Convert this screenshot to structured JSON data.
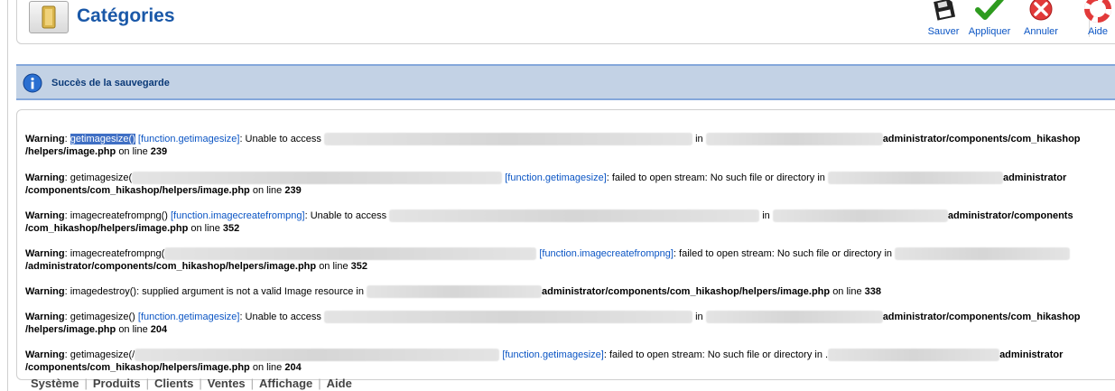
{
  "header": {
    "title": "Catégories",
    "buttons": {
      "save": "Sauver",
      "apply": "Appliquer",
      "cancel": "Annuler",
      "help": "Aide"
    }
  },
  "message": {
    "text": "Succès de la sauvegarde"
  },
  "warnings": {
    "label": "Warning",
    "w1": {
      "fn": "getimagesize()",
      "link": "[function.getimagesize]",
      "t1": ": Unable to access",
      "t2": "in",
      "path1": "administrator/components/com_hikashop",
      "path2": "/helpers/image.php",
      "online": "on line",
      "line": "239"
    },
    "w2": {
      "fn": ": getimagesize(",
      "link": "[function.getimagesize]",
      "t1": ": failed to open stream: No such file or directory in",
      "path1": "administrator",
      "path2": "/components/com_hikashop/helpers/image.php",
      "online": "on line",
      "line": "239"
    },
    "w3": {
      "fn": ": imagecreatefrompng()",
      "link": "[function.imagecreatefrompng]",
      "t1": ": Unable to access",
      "t2": "in",
      "path1": "administrator/components",
      "path2": "/com_hikashop/helpers/image.php",
      "online": "on line",
      "line": "352"
    },
    "w4": {
      "fn": ": imagecreatefrompng(",
      "link": "[function.imagecreatefrompng]",
      "t1": ": failed to open stream: No such file or directory in",
      "path2": "/administrator/components/com_hikashop/helpers/image.php",
      "online": "on line",
      "line": "352"
    },
    "w5": {
      "fn": ": imagedestroy(): supplied argument is not a valid Image resource in",
      "path1": "administrator/components/com_hikashop/helpers/image.php",
      "online": "on line",
      "line": "338"
    },
    "w6": {
      "fn": ": getimagesize()",
      "link": "[function.getimagesize]",
      "t1": ": Unable to access",
      "t2": "in",
      "path1": "administrator/components/com_hikashop",
      "path2": "/helpers/image.php",
      "online": "on line",
      "line": "204"
    },
    "w7": {
      "fn": ": getimagesize(/",
      "link": "[function.getimagesize]",
      "t1": ": failed to open stream: No such file or directory in .",
      "path1": "administrator",
      "path2": "/components/com_hikashop/helpers/image.php",
      "online": "on line",
      "line": "204"
    }
  },
  "menu": [
    "Système",
    "Produits",
    "Clients",
    "Ventes",
    "Affichage",
    "Aide"
  ],
  "colors": {
    "title": "#1a58a8",
    "link": "#0b55c4",
    "message_bg": "#c3d2e5",
    "message_border": "#84a7db"
  },
  "icons": {
    "title": "categories-folder-icon",
    "save": "floppy-disk-icon",
    "apply": "checkmark-icon",
    "cancel": "cancel-x-icon",
    "help": "lifebuoy-icon",
    "message": "info-icon"
  }
}
